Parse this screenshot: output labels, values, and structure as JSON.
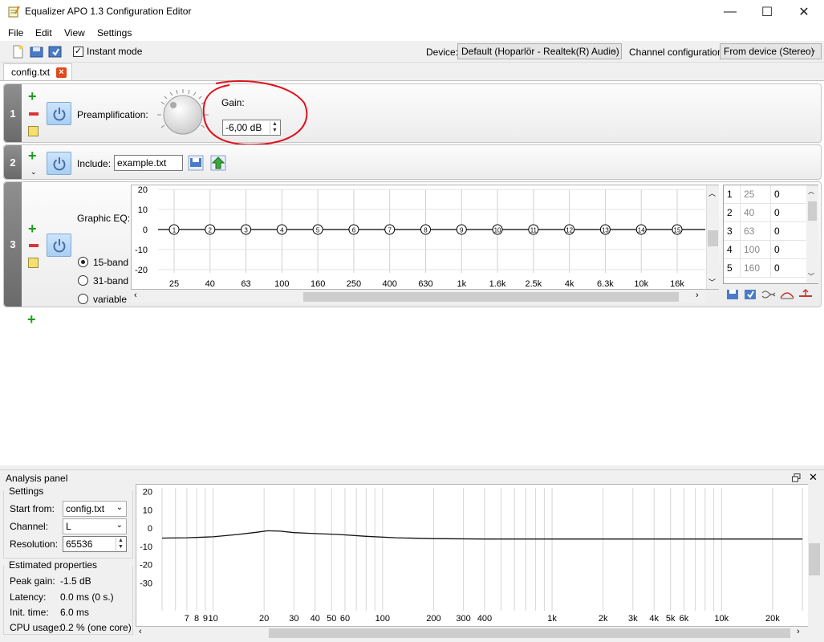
{
  "window": {
    "title": "Equalizer APO 1.3 Configuration Editor",
    "minimize_glyph": "—",
    "maximize_glyph": "☐",
    "close_glyph": "✕"
  },
  "menu": [
    "File",
    "Edit",
    "View",
    "Settings"
  ],
  "toolbar": {
    "instant_mode_label": "Instant mode",
    "instant_mode_checked": true,
    "device_label": "Device:",
    "device_value": "Default (Hoparlör - Realtek(R) Audio)",
    "channel_config_label": "Channel configuration:",
    "channel_config_value": "From device (Stereo)"
  },
  "tabs": [
    {
      "label": "config.txt"
    }
  ],
  "rows": {
    "preamp": {
      "number": "1",
      "label": "Preamplification:",
      "gain_label": "Gain:",
      "gain_value": "-6,00 dB"
    },
    "include": {
      "number": "2",
      "label": "Include:",
      "file_value": "example.txt"
    },
    "graphic_eq": {
      "number": "3",
      "label": "Graphic EQ:",
      "mode_options": [
        "15-band",
        "31-band",
        "variable"
      ],
      "mode_selected": "15-band"
    }
  },
  "chart_data": [
    {
      "type": "line",
      "title": "",
      "xlabel": "",
      "ylabel": "",
      "x_categories": [
        "25",
        "40",
        "63",
        "100",
        "160",
        "250",
        "400",
        "630",
        "1k",
        "1.6k",
        "2.5k",
        "4k",
        "6.3k",
        "10k",
        "16k"
      ],
      "band_labels": [
        "1",
        "2",
        "3",
        "4",
        "5",
        "6",
        "7",
        "8",
        "9",
        "10",
        "11",
        "12",
        "13",
        "14",
        "15"
      ],
      "series": [
        {
          "values": [
            0,
            0,
            0,
            0,
            0,
            0,
            0,
            0,
            0,
            0,
            0,
            0,
            0,
            0,
            0
          ]
        }
      ],
      "y_ticks": [
        "20",
        "10",
        "0",
        "-10",
        "-20"
      ],
      "ylim": [
        -20,
        20
      ]
    },
    {
      "type": "line",
      "title": "",
      "xlabel": "",
      "ylabel": "",
      "x_scale": "log",
      "x_tick_labels": [
        "7",
        "8",
        "9",
        "10",
        "20",
        "30",
        "40",
        "50",
        "60",
        "100",
        "200",
        "300",
        "400",
        "1k",
        "2k",
        "3k",
        "4k",
        "5k",
        "6k",
        "10k",
        "20k"
      ],
      "x_ticks": [
        7,
        8,
        9,
        10,
        20,
        30,
        40,
        50,
        60,
        100,
        200,
        300,
        400,
        1000,
        2000,
        3000,
        4000,
        5000,
        6000,
        10000,
        20000
      ],
      "y_ticks": [
        "20",
        "10",
        "0",
        "-10",
        "-20",
        "-30"
      ],
      "ylim": [
        -40,
        22
      ],
      "x": [
        5,
        7,
        10,
        14,
        18,
        21,
        25,
        30,
        40,
        55,
        80,
        120,
        200,
        400,
        1000,
        5000,
        20000,
        30000
      ],
      "series": [
        {
          "values": [
            -5.5,
            -5.3,
            -4.8,
            -3.5,
            -2.3,
            -1.5,
            -1.7,
            -2.5,
            -3.0,
            -3.5,
            -4.5,
            -5.3,
            -5.8,
            -6.0,
            -6.0,
            -6.0,
            -6.0,
            -6.0
          ]
        }
      ]
    }
  ],
  "mini_table": [
    {
      "index": "1",
      "freq": "25",
      "gain": "0"
    },
    {
      "index": "2",
      "freq": "40",
      "gain": "0"
    },
    {
      "index": "3",
      "freq": "63",
      "gain": "0"
    },
    {
      "index": "4",
      "freq": "100",
      "gain": "0"
    },
    {
      "index": "5",
      "freq": "160",
      "gain": "0"
    }
  ],
  "analysis": {
    "title": "Analysis panel",
    "settings_title": "Settings",
    "start_from_label": "Start from:",
    "start_from_value": "config.txt",
    "channel_label": "Channel:",
    "channel_value": "L",
    "resolution_label": "Resolution:",
    "resolution_value": "65536",
    "estimated_title": "Estimated properties",
    "peak_gain_label": "Peak gain:",
    "peak_gain_value": "-1.5 dB",
    "latency_label": "Latency:",
    "latency_value": "0.0 ms (0 s.)",
    "init_time_label": "Init. time:",
    "init_time_value": "6.0 ms",
    "cpu_usage_label": "CPU usage:",
    "cpu_usage_value": "0.2 % (one core)"
  },
  "colors": {
    "annotation": "#e0101b",
    "plus": "#1b9c1b",
    "power_bg": "#b9d8f7",
    "row_num_bg": "#7a7a7a"
  }
}
